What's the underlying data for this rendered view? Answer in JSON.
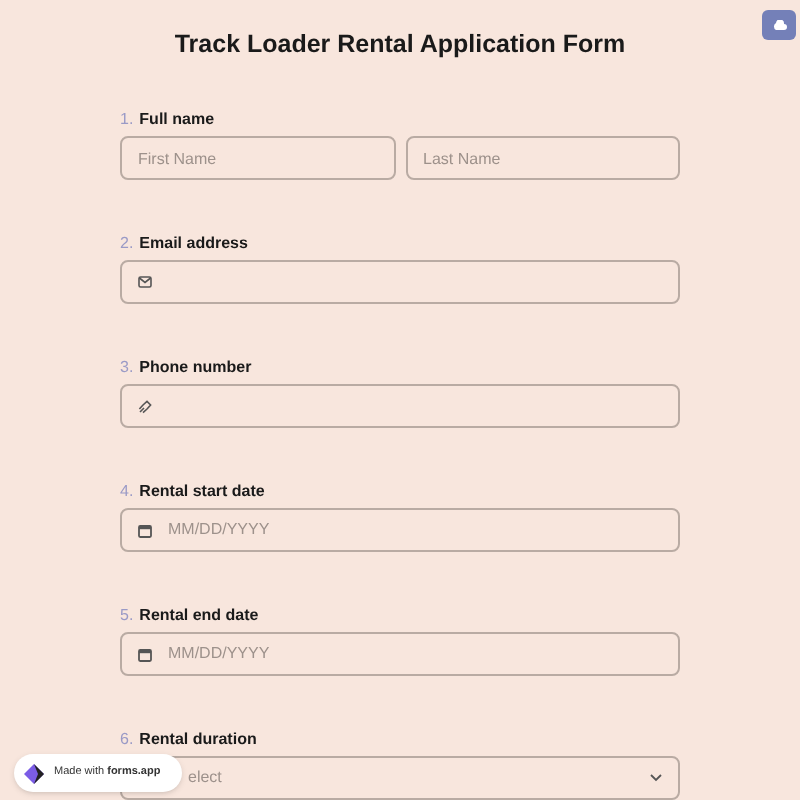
{
  "title": "Track Loader Rental Application Form",
  "questions": [
    {
      "number": "1.",
      "label": "Full name",
      "kind": "name",
      "fields": [
        {
          "placeholder": "First Name"
        },
        {
          "placeholder": "Last Name"
        }
      ]
    },
    {
      "number": "2.",
      "label": "Email address",
      "kind": "email"
    },
    {
      "number": "3.",
      "label": "Phone number",
      "kind": "phone"
    },
    {
      "number": "4.",
      "label": "Rental start date",
      "kind": "date",
      "placeholder": "MM/DD/YYYY"
    },
    {
      "number": "5.",
      "label": "Rental end date",
      "kind": "date",
      "placeholder": "MM/DD/YYYY"
    },
    {
      "number": "6.",
      "label": "Rental duration",
      "kind": "select",
      "placeholder": "elect"
    }
  ],
  "badge": "Made with **forms.app**"
}
